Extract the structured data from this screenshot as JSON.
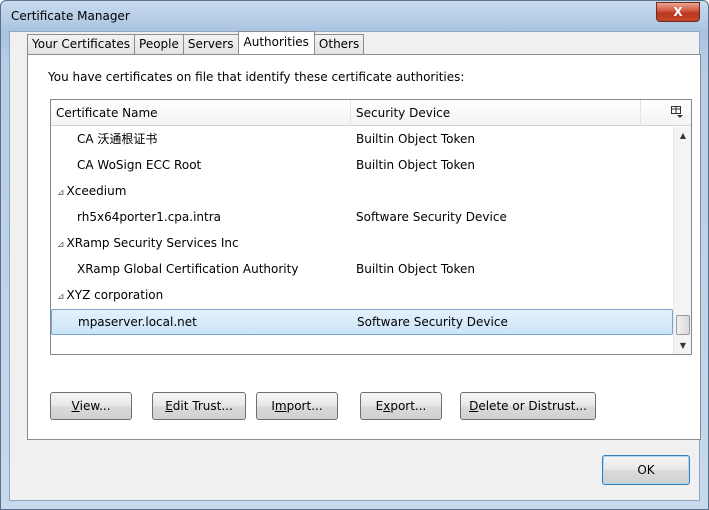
{
  "window": {
    "title": "Certificate Manager",
    "close_label": "X"
  },
  "tabs": [
    {
      "label": "Your Certificates",
      "active": false
    },
    {
      "label": "People",
      "active": false
    },
    {
      "label": "Servers",
      "active": false
    },
    {
      "label": "Authorities",
      "active": true
    },
    {
      "label": "Others",
      "active": false
    }
  ],
  "panel": {
    "intro": "You have certificates on file that identify these certificate authorities:"
  },
  "tree": {
    "columns": {
      "name": "Certificate Name",
      "device": "Security Device"
    },
    "rows": [
      {
        "type": "cert",
        "name": "CA 沃通根证书",
        "device": "Builtin Object Token",
        "selected": false
      },
      {
        "type": "cert",
        "name": "CA WoSign ECC Root",
        "device": "Builtin Object Token",
        "selected": false
      },
      {
        "type": "group",
        "twisty": "⊿",
        "name": "Xceedium",
        "device": "",
        "selected": false
      },
      {
        "type": "cert",
        "name": "rh5x64porter1.cpa.intra",
        "device": "Software Security Device",
        "selected": false
      },
      {
        "type": "group",
        "twisty": "⊿",
        "name": "XRamp Security Services Inc",
        "device": "",
        "selected": false
      },
      {
        "type": "cert",
        "name": "XRamp Global Certification Authority",
        "device": "Builtin Object Token",
        "selected": false
      },
      {
        "type": "group",
        "twisty": "⊿",
        "name": "XYZ corporation",
        "device": "",
        "selected": false
      },
      {
        "type": "cert",
        "name": "mpaserver.local.net",
        "device": "Software Security Device",
        "selected": true
      }
    ]
  },
  "buttons": {
    "view": {
      "mnemonic": "V",
      "rest": "iew..."
    },
    "edit_trust": {
      "mnemonic": "E",
      "rest": "dit Trust..."
    },
    "import": {
      "pre": "I",
      "mnemonic": "m",
      "rest": "port..."
    },
    "export": {
      "pre": "E",
      "mnemonic": "x",
      "rest": "port..."
    },
    "delete": {
      "mnemonic": "D",
      "rest": "elete or Distrust..."
    },
    "ok": "OK"
  }
}
